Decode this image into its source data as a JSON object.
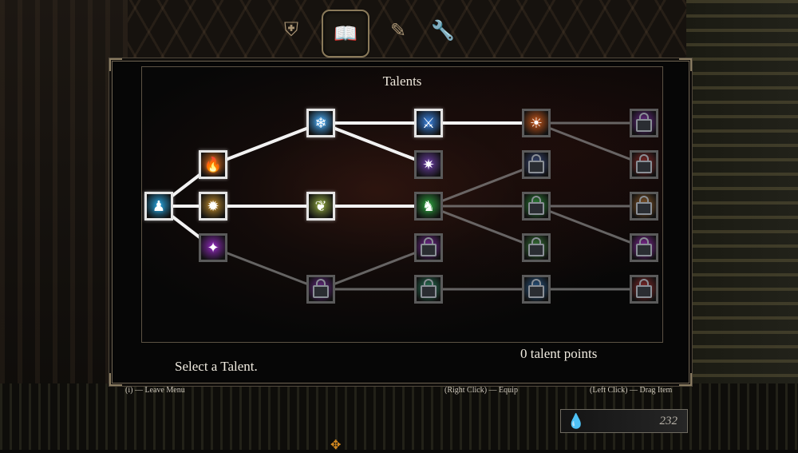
{
  "panel": {
    "title": "Talents"
  },
  "tabs": [
    {
      "id": "tab-gear",
      "icon": "armor-icon",
      "glyph": "⛨",
      "active": false
    },
    {
      "id": "tab-talents",
      "icon": "book-icon",
      "glyph": "📖",
      "active": true
    },
    {
      "id": "tab-map",
      "icon": "scroll-icon",
      "glyph": "✎",
      "active": false
    },
    {
      "id": "tab-settings",
      "icon": "wrench-icon",
      "glyph": "🔧",
      "active": false
    }
  ],
  "talents": [
    {
      "id": "root",
      "icon": "shadow-figure-icon",
      "glyph": "♟",
      "state": "unlocked",
      "color": "#2a9fd6"
    },
    {
      "id": "t1-fire",
      "icon": "fire-slash-icon",
      "glyph": "🔥",
      "state": "unlocked",
      "color": "#d2691e"
    },
    {
      "id": "t1-burst",
      "icon": "burst-icon",
      "glyph": "✹",
      "state": "unlocked",
      "color": "#b8872f"
    },
    {
      "id": "t1-void",
      "icon": "void-claw-icon",
      "glyph": "✦",
      "state": "locked",
      "color": "#8e2bb8"
    },
    {
      "id": "t2-ice",
      "icon": "ice-crystal-icon",
      "glyph": "❄",
      "state": "unlocked",
      "color": "#4aa8f0"
    },
    {
      "id": "t2-nature",
      "icon": "nature-icon",
      "glyph": "❦",
      "state": "unlocked",
      "color": "#8aa040"
    },
    {
      "id": "t2-lock",
      "icon": "lock-icon",
      "glyph": "",
      "state": "locked",
      "color": "#6b2c8a"
    },
    {
      "id": "t3-blade",
      "icon": "blade-icon",
      "glyph": "⚔",
      "state": "unlocked",
      "color": "#3a7fd8"
    },
    {
      "id": "t3-star",
      "icon": "star-burst-icon",
      "glyph": "✷",
      "state": "locked",
      "color": "#6a3fa0"
    },
    {
      "id": "t3-green",
      "icon": "green-figure-icon",
      "glyph": "♞",
      "state": "locked",
      "color": "#2e9a3e"
    },
    {
      "id": "t3-lock-a",
      "icon": "lock-icon",
      "glyph": "",
      "state": "locked",
      "color": "#7a2a9a"
    },
    {
      "id": "t3-lock-b",
      "icon": "lock-icon",
      "glyph": "",
      "state": "locked",
      "color": "#2a7a5a"
    },
    {
      "id": "t4-orb",
      "icon": "fire-orb-icon",
      "glyph": "☀",
      "state": "locked",
      "color": "#c2561c"
    },
    {
      "id": "t4-lock-a",
      "icon": "lock-icon",
      "glyph": "",
      "state": "locked",
      "color": "#3a4a7a"
    },
    {
      "id": "t4-lock-b",
      "icon": "lock-icon",
      "glyph": "",
      "state": "locked",
      "color": "#2e8a3a"
    },
    {
      "id": "t4-lock-c",
      "icon": "lock-icon",
      "glyph": "",
      "state": "locked",
      "color": "#3a7a3a"
    },
    {
      "id": "t4-lock-d",
      "icon": "lock-icon",
      "glyph": "",
      "state": "locked",
      "color": "#2a5a8a"
    },
    {
      "id": "t5-lock-a",
      "icon": "lock-icon",
      "glyph": "",
      "state": "locked",
      "color": "#6a2a8a"
    },
    {
      "id": "t5-lock-b",
      "icon": "lock-icon",
      "glyph": "",
      "state": "locked",
      "color": "#8a2a2a"
    },
    {
      "id": "t5-lock-c",
      "icon": "lock-icon",
      "glyph": "",
      "state": "locked",
      "color": "#8a5a2a"
    },
    {
      "id": "t5-lock-d",
      "icon": "lock-icon",
      "glyph": "",
      "state": "locked",
      "color": "#8a2aa0"
    },
    {
      "id": "t5-lock-e",
      "icon": "lock-icon",
      "glyph": "",
      "state": "locked",
      "color": "#8a2a2a"
    }
  ],
  "links": [
    {
      "from": "root",
      "to": "t1-fire",
      "active": true
    },
    {
      "from": "root",
      "to": "t1-burst",
      "active": true
    },
    {
      "from": "root",
      "to": "t1-void",
      "active": true
    },
    {
      "from": "t1-fire",
      "to": "t2-ice",
      "active": true
    },
    {
      "from": "t1-burst",
      "to": "t2-nature",
      "active": true
    },
    {
      "from": "t1-void",
      "to": "t2-lock",
      "active": false
    },
    {
      "from": "t2-ice",
      "to": "t3-blade",
      "active": true
    },
    {
      "from": "t2-ice",
      "to": "t3-star",
      "active": true
    },
    {
      "from": "t2-nature",
      "to": "t3-green",
      "active": true
    },
    {
      "from": "t2-lock",
      "to": "t3-lock-a",
      "active": false
    },
    {
      "from": "t2-lock",
      "to": "t3-lock-b",
      "active": false
    },
    {
      "from": "t3-blade",
      "to": "t4-orb",
      "active": true
    },
    {
      "from": "t3-green",
      "to": "t4-lock-a",
      "active": false
    },
    {
      "from": "t3-green",
      "to": "t4-lock-b",
      "active": false
    },
    {
      "from": "t3-green",
      "to": "t4-lock-c",
      "active": false
    },
    {
      "from": "t3-lock-b",
      "to": "t4-lock-d",
      "active": false
    },
    {
      "from": "t4-orb",
      "to": "t5-lock-a",
      "active": false
    },
    {
      "from": "t4-orb",
      "to": "t5-lock-b",
      "active": false
    },
    {
      "from": "t4-lock-b",
      "to": "t5-lock-c",
      "active": false
    },
    {
      "from": "t4-lock-b",
      "to": "t5-lock-d",
      "active": false
    },
    {
      "from": "t4-lock-d",
      "to": "t5-lock-e",
      "active": false
    }
  ],
  "status": {
    "prompt": "Select a Talent.",
    "points": "0 talent points"
  },
  "hints": {
    "leave": "(i) — Leave Menu",
    "equip": "(Right Click) — Equip",
    "drag": "(Left Click) — Drag Item"
  },
  "currency": {
    "icon": "soul-drop-icon",
    "glyph": "💧",
    "value": "232"
  },
  "colors": {
    "active_link": "#f2f2f2",
    "inactive_link": "#8a8a8a",
    "frame": "#6e6352"
  }
}
